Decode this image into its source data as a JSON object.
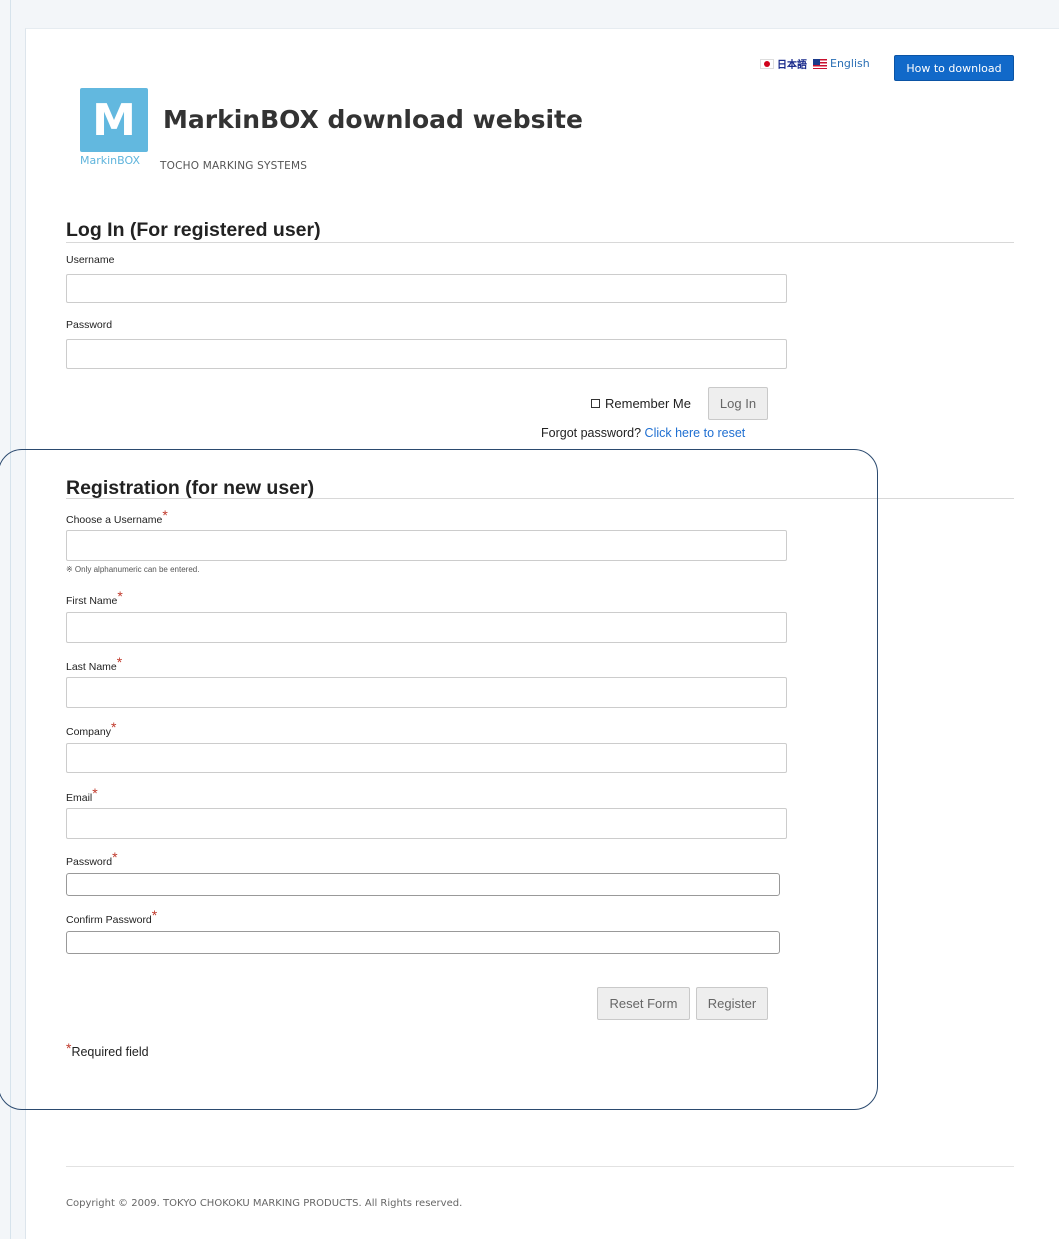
{
  "header": {
    "lang_japanese": "日本語",
    "lang_english": "English",
    "how_to_download": "How to download",
    "logo_letter": "M",
    "logo_text": "MarkinBOX",
    "site_title": "MarkinBOX download website",
    "site_subtitle": "TOCHO MARKING SYSTEMS"
  },
  "login": {
    "title": "Log In (For registered user)",
    "username_label": "Username",
    "username_value": "",
    "password_label": "Password",
    "password_value": "",
    "remember_me": "Remember Me",
    "login_button": "Log In",
    "forgot_text": "Forgot password?",
    "reset_link": "Click here to reset"
  },
  "registration": {
    "title": "Registration (for new user)",
    "fields": {
      "username": "Choose a Username",
      "username_hint": "※ Only alphanumeric can be entered.",
      "first_name": "First Name",
      "last_name": "Last Name",
      "company": "Company",
      "email": "Email",
      "password": "Password",
      "confirm_password": "Confirm Password"
    },
    "required_marker": "*",
    "reset_button": "Reset Form",
    "register_button": "Register",
    "required_note": "Required field"
  },
  "footer": {
    "copyright": "Copyright © 2009. TOKYO CHOKOKU MARKING PRODUCTS. All Rights reserved."
  },
  "colors": {
    "accent": "#1169c9",
    "link": "#1f6fd1",
    "required": "#c0392b",
    "logo": "#62b8df",
    "highlight_frame": "#2b4a6f"
  }
}
